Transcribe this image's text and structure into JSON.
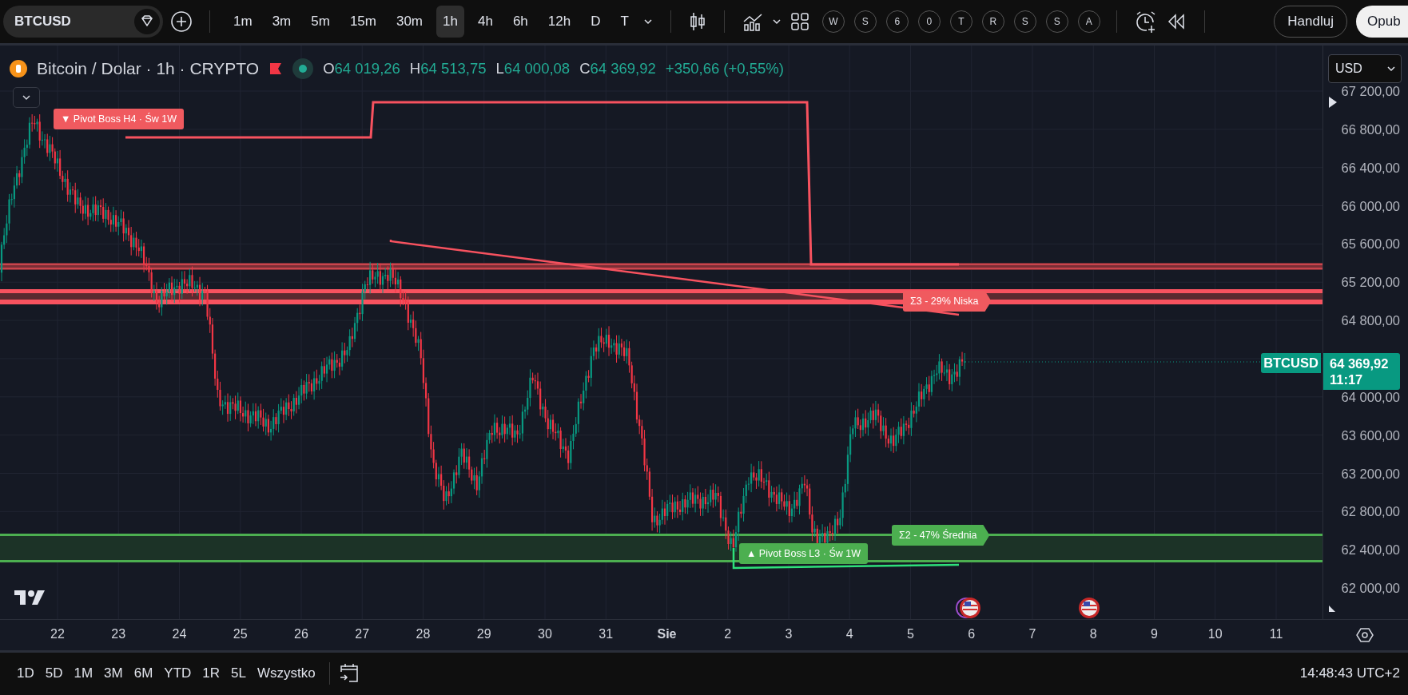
{
  "toolbar": {
    "symbol": "BTCUSD",
    "intervals": [
      {
        "label": "1m",
        "selected": false
      },
      {
        "label": "3m",
        "selected": false
      },
      {
        "label": "5m",
        "selected": false
      },
      {
        "label": "15m",
        "selected": false
      },
      {
        "label": "30m",
        "selected": false
      },
      {
        "label": "1h",
        "selected": true
      },
      {
        "label": "4h",
        "selected": false
      },
      {
        "label": "6h",
        "selected": false
      },
      {
        "label": "12h",
        "selected": false
      },
      {
        "label": "D",
        "selected": false
      },
      {
        "label": "T",
        "selected": false
      }
    ],
    "letters": [
      "W",
      "S",
      "6",
      "0",
      "T",
      "R",
      "S",
      "S",
      "A"
    ],
    "trade_button": "Handluj",
    "publish_button": "Opub"
  },
  "legend": {
    "title": "Bitcoin / Dolar · 1h · CRYPTO",
    "ohlc": [
      {
        "label": "O",
        "value": "64 019,26"
      },
      {
        "label": "H",
        "value": "64 513,75"
      },
      {
        "label": "L",
        "value": "64 000,08"
      },
      {
        "label": "C",
        "value": "64 369,92"
      }
    ],
    "change": "+350,66 (+0,55%)"
  },
  "currency": "USD",
  "price_scale": [
    "67 200,00",
    "66 800,00",
    "66 400,00",
    "66 000,00",
    "65 600,00",
    "65 200,00",
    "64 800,00",
    "64 000,00",
    "63 600,00",
    "63 200,00",
    "62 800,00",
    "62 400,00",
    "62 000,00"
  ],
  "last_price": {
    "symbol": "BTCUSD",
    "price": "64 369,92",
    "countdown": "11:17"
  },
  "annotations": [
    {
      "kind": "pivot",
      "text": "▼ Pivot Boss H4 · Św 1W",
      "color": "#f05a5f"
    },
    {
      "kind": "sigma",
      "text": "Σ3 - 29% Niska",
      "color": "#f05a5f"
    },
    {
      "kind": "sigma",
      "text": "Σ2 - 47% Średnia",
      "color": "#4caf50"
    },
    {
      "kind": "pivot",
      "text": "▲ Pivot Boss L3 · Św 1W",
      "color": "#4caf50"
    }
  ],
  "time_axis": [
    "22",
    "23",
    "24",
    "25",
    "26",
    "27",
    "28",
    "29",
    "30",
    "31",
    "Sie",
    "2",
    "3",
    "4",
    "5",
    "6",
    "7",
    "8",
    "9",
    "10",
    "11"
  ],
  "ranges": [
    "1D",
    "5D",
    "1M",
    "3M",
    "6M",
    "YTD",
    "1R",
    "5L",
    "Wszystko"
  ],
  "clock": "14:48:43 UTC+2"
}
